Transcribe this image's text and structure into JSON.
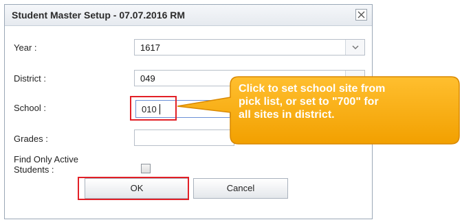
{
  "dialog": {
    "title": "Student Master Setup - 07.07.2016 RM",
    "close_icon": "close-icon"
  },
  "fields": {
    "year": {
      "label": "Year :",
      "value": "1617"
    },
    "district": {
      "label": "District :",
      "value": "049"
    },
    "school": {
      "label": "School :",
      "value": "010"
    },
    "grades": {
      "label": "Grades :",
      "value": ""
    },
    "active_only": {
      "label_line1": "Find Only Active",
      "label_line2": "Students :",
      "checked": false
    }
  },
  "buttons": {
    "ok_label": "OK",
    "cancel_label": "Cancel"
  },
  "callout": {
    "line1": "Click to set school site from",
    "line2": "pick list, or set to \"700\" for",
    "line3": "all sites in district."
  },
  "colors": {
    "highlight": "#e21f26",
    "callout_fill": "#f5a800",
    "callout_border": "#e38f00"
  }
}
